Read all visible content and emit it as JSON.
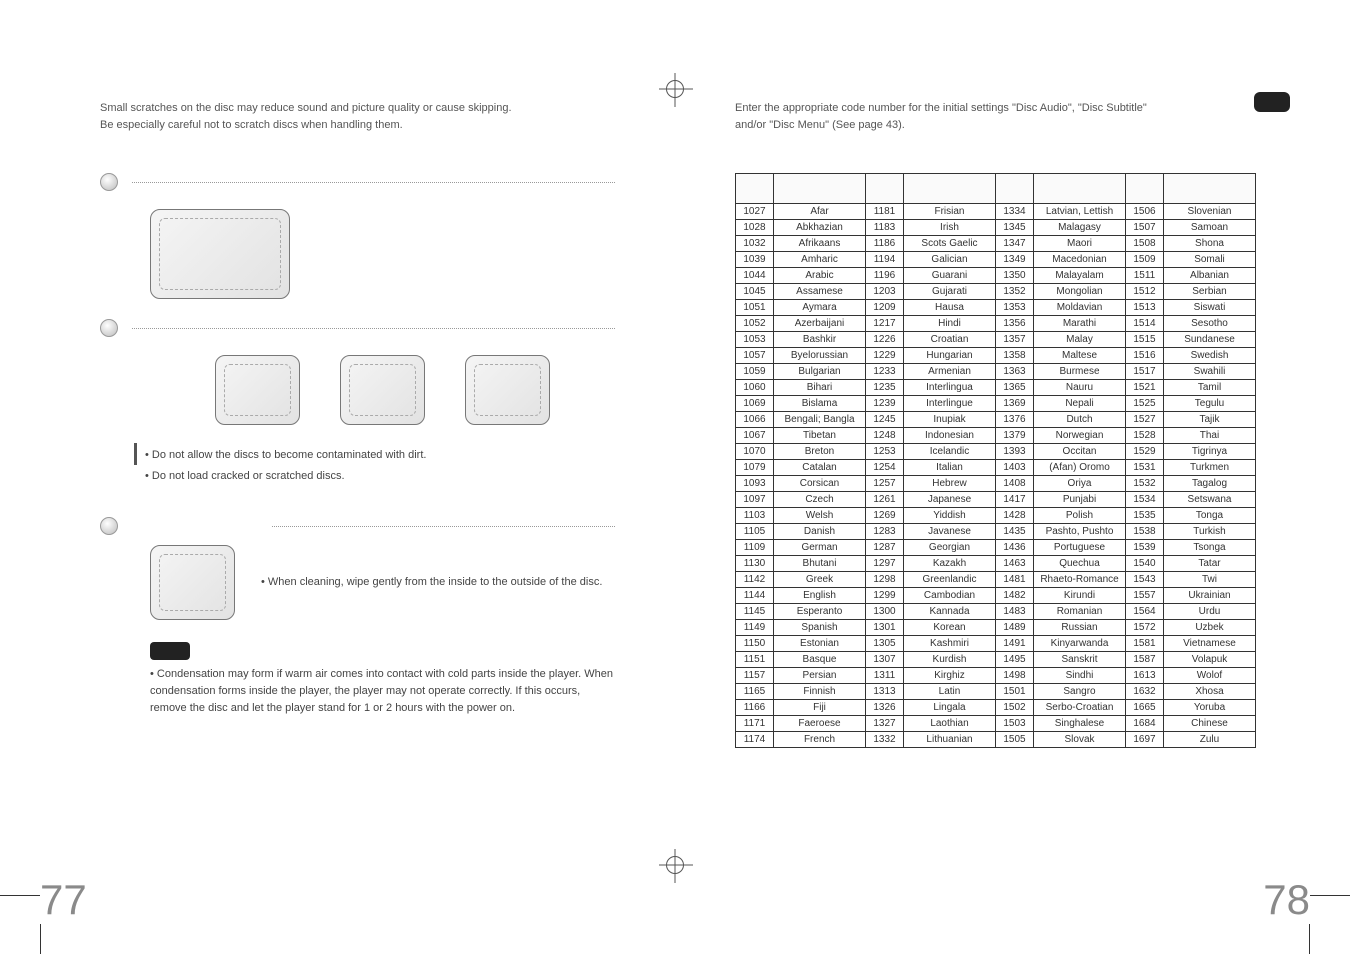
{
  "left": {
    "intro1": "Small scratches on the disc may reduce sound and picture quality or cause skipping.",
    "intro2": "Be especially careful not to scratch discs when handling them.",
    "bullets1": [
      "• Do not allow the discs to become contaminated with dirt.",
      "• Do not load cracked or scratched discs."
    ],
    "bullet_clean": "• When cleaning, wipe gently from the inside to the outside of the disc.",
    "note": "• Condensation may form if warm air comes into contact with cold parts inside the player. When condensation forms inside the player, the player may not operate correctly. If this occurs, remove the disc and let the player stand for 1 or 2 hours with the power on.",
    "pagenum": "77"
  },
  "right": {
    "intro1": "Enter the appropriate code number for the initial settings \"Disc Audio\", \"Disc Subtitle\"",
    "intro2": "and/or \"Disc Menu\" (See page 43).",
    "pagenum": "78",
    "rows": [
      [
        "1027",
        "Afar",
        "1181",
        "Frisian",
        "1334",
        "Latvian, Lettish",
        "1506",
        "Slovenian"
      ],
      [
        "1028",
        "Abkhazian",
        "1183",
        "Irish",
        "1345",
        "Malagasy",
        "1507",
        "Samoan"
      ],
      [
        "1032",
        "Afrikaans",
        "1186",
        "Scots Gaelic",
        "1347",
        "Maori",
        "1508",
        "Shona"
      ],
      [
        "1039",
        "Amharic",
        "1194",
        "Galician",
        "1349",
        "Macedonian",
        "1509",
        "Somali"
      ],
      [
        "1044",
        "Arabic",
        "1196",
        "Guarani",
        "1350",
        "Malayalam",
        "1511",
        "Albanian"
      ],
      [
        "1045",
        "Assamese",
        "1203",
        "Gujarati",
        "1352",
        "Mongolian",
        "1512",
        "Serbian"
      ],
      [
        "1051",
        "Aymara",
        "1209",
        "Hausa",
        "1353",
        "Moldavian",
        "1513",
        "Siswati"
      ],
      [
        "1052",
        "Azerbaijani",
        "1217",
        "Hindi",
        "1356",
        "Marathi",
        "1514",
        "Sesotho"
      ],
      [
        "1053",
        "Bashkir",
        "1226",
        "Croatian",
        "1357",
        "Malay",
        "1515",
        "Sundanese"
      ],
      [
        "1057",
        "Byelorussian",
        "1229",
        "Hungarian",
        "1358",
        "Maltese",
        "1516",
        "Swedish"
      ],
      [
        "1059",
        "Bulgarian",
        "1233",
        "Armenian",
        "1363",
        "Burmese",
        "1517",
        "Swahili"
      ],
      [
        "1060",
        "Bihari",
        "1235",
        "Interlingua",
        "1365",
        "Nauru",
        "1521",
        "Tamil"
      ],
      [
        "1069",
        "Bislama",
        "1239",
        "Interlingue",
        "1369",
        "Nepali",
        "1525",
        "Tegulu"
      ],
      [
        "1066",
        "Bengali; Bangla",
        "1245",
        "Inupiak",
        "1376",
        "Dutch",
        "1527",
        "Tajik"
      ],
      [
        "1067",
        "Tibetan",
        "1248",
        "Indonesian",
        "1379",
        "Norwegian",
        "1528",
        "Thai"
      ],
      [
        "1070",
        "Breton",
        "1253",
        "Icelandic",
        "1393",
        "Occitan",
        "1529",
        "Tigrinya"
      ],
      [
        "1079",
        "Catalan",
        "1254",
        "Italian",
        "1403",
        "(Afan) Oromo",
        "1531",
        "Turkmen"
      ],
      [
        "1093",
        "Corsican",
        "1257",
        "Hebrew",
        "1408",
        "Oriya",
        "1532",
        "Tagalog"
      ],
      [
        "1097",
        "Czech",
        "1261",
        "Japanese",
        "1417",
        "Punjabi",
        "1534",
        "Setswana"
      ],
      [
        "1103",
        "Welsh",
        "1269",
        "Yiddish",
        "1428",
        "Polish",
        "1535",
        "Tonga"
      ],
      [
        "1105",
        "Danish",
        "1283",
        "Javanese",
        "1435",
        "Pashto, Pushto",
        "1538",
        "Turkish"
      ],
      [
        "1109",
        "German",
        "1287",
        "Georgian",
        "1436",
        "Portuguese",
        "1539",
        "Tsonga"
      ],
      [
        "1130",
        "Bhutani",
        "1297",
        "Kazakh",
        "1463",
        "Quechua",
        "1540",
        "Tatar"
      ],
      [
        "1142",
        "Greek",
        "1298",
        "Greenlandic",
        "1481",
        "Rhaeto-Romance",
        "1543",
        "Twi"
      ],
      [
        "1144",
        "English",
        "1299",
        "Cambodian",
        "1482",
        "Kirundi",
        "1557",
        "Ukrainian"
      ],
      [
        "1145",
        "Esperanto",
        "1300",
        "Kannada",
        "1483",
        "Romanian",
        "1564",
        "Urdu"
      ],
      [
        "1149",
        "Spanish",
        "1301",
        "Korean",
        "1489",
        "Russian",
        "1572",
        "Uzbek"
      ],
      [
        "1150",
        "Estonian",
        "1305",
        "Kashmiri",
        "1491",
        "Kinyarwanda",
        "1581",
        "Vietnamese"
      ],
      [
        "1151",
        "Basque",
        "1307",
        "Kurdish",
        "1495",
        "Sanskrit",
        "1587",
        "Volapuk"
      ],
      [
        "1157",
        "Persian",
        "1311",
        "Kirghiz",
        "1498",
        "Sindhi",
        "1613",
        "Wolof"
      ],
      [
        "1165",
        "Finnish",
        "1313",
        "Latin",
        "1501",
        "Sangro",
        "1632",
        "Xhosa"
      ],
      [
        "1166",
        "Fiji",
        "1326",
        "Lingala",
        "1502",
        "Serbo-Croatian",
        "1665",
        "Yoruba"
      ],
      [
        "1171",
        "Faeroese",
        "1327",
        "Laothian",
        "1503",
        "Singhalese",
        "1684",
        "Chinese"
      ],
      [
        "1174",
        "French",
        "1332",
        "Lithuanian",
        "1505",
        "Slovak",
        "1697",
        "Zulu"
      ]
    ]
  }
}
